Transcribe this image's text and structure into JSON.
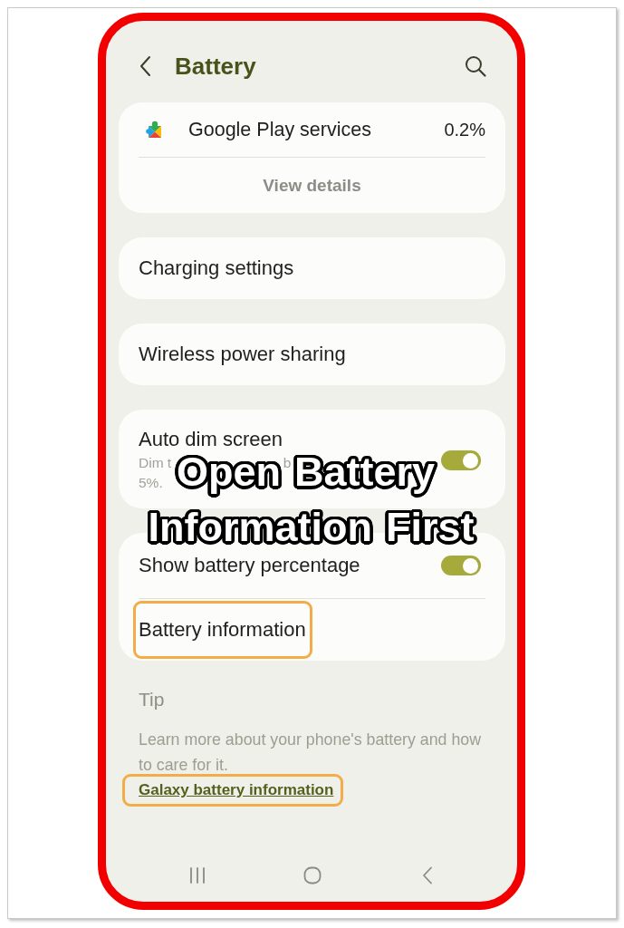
{
  "header": {
    "title": "Battery"
  },
  "app_usage": {
    "app": "Google Play services",
    "usage": "0.2%",
    "action": "View details"
  },
  "settings_groups": [
    {
      "items": [
        {
          "kind": "link",
          "label": "Charging settings",
          "highlighted": false
        }
      ]
    },
    {
      "items": [
        {
          "kind": "link",
          "label": "Wireless power sharing",
          "highlighted": false
        }
      ]
    },
    {
      "items": [
        {
          "kind": "toggle",
          "label": "Auto dim screen",
          "description_fragments": [
            [
              "Dim t",
              "b"
            ],
            [
              "5%."
            ]
          ],
          "on": true,
          "highlighted": false
        }
      ]
    },
    {
      "items": [
        {
          "kind": "toggle",
          "label": "Show battery percentage",
          "on": true,
          "highlighted": false
        },
        {
          "kind": "link",
          "label": "Battery information",
          "highlighted": true
        }
      ]
    }
  ],
  "tip": {
    "title": "Tip",
    "text": "Learn more about your phone's battery and how to care for it.",
    "link": {
      "label": "Galaxy battery information",
      "highlighted": true
    }
  },
  "overlay_caption": {
    "lines": [
      "Open Battery",
      "Information First"
    ]
  }
}
